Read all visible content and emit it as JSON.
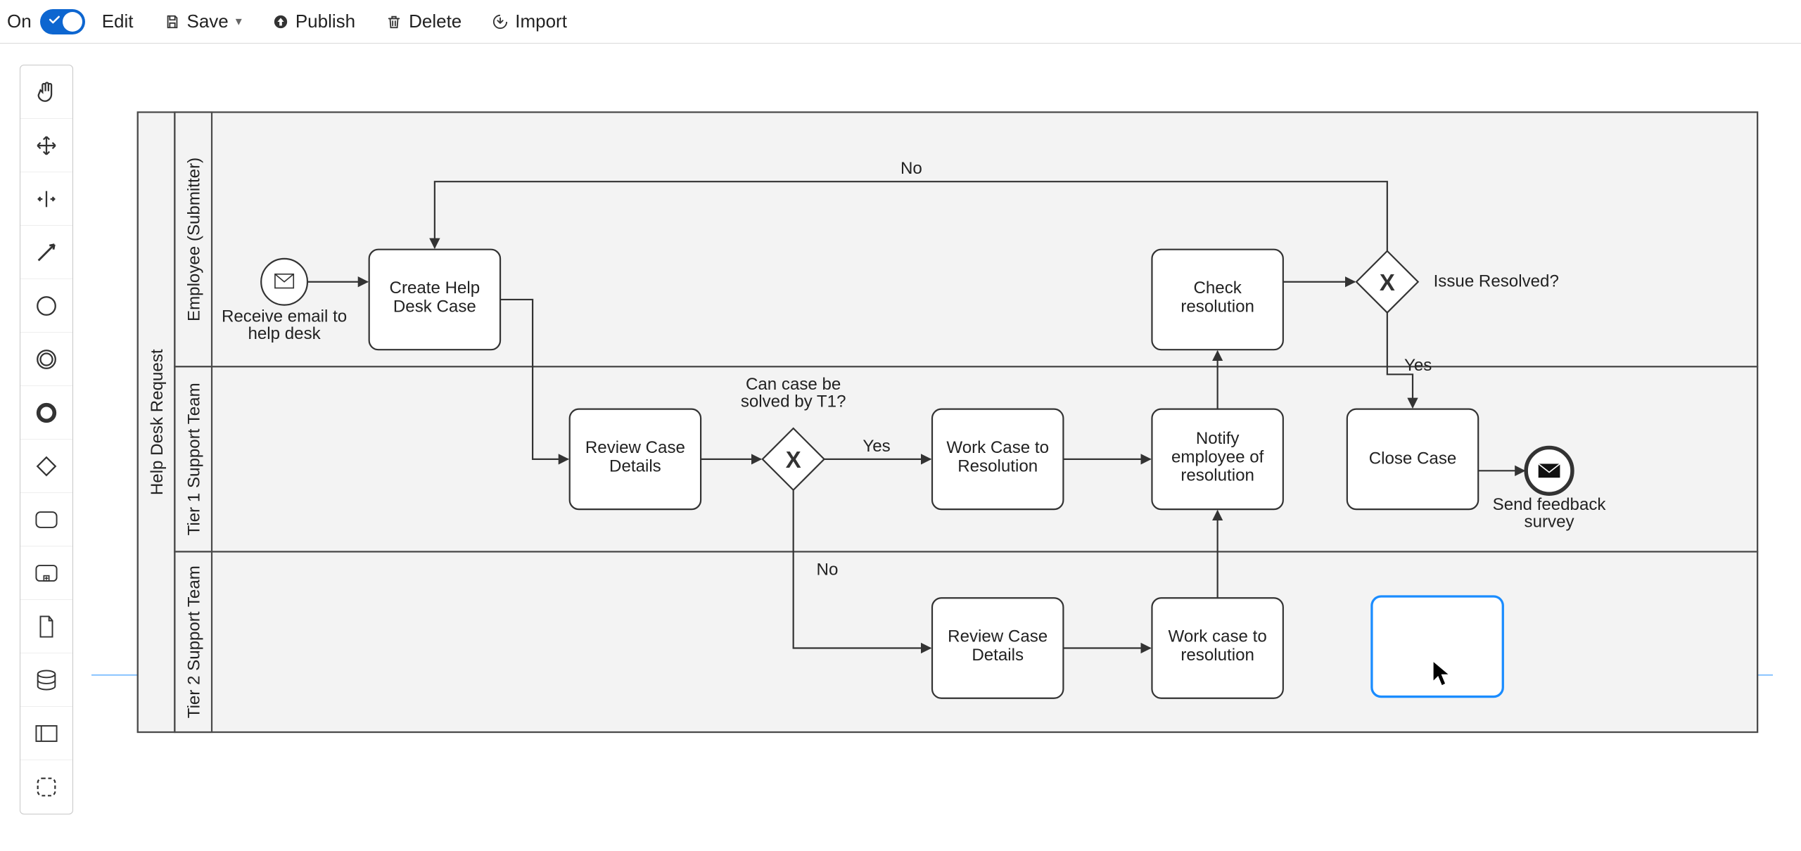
{
  "toolbar": {
    "on_label": "On",
    "toggle_on": true,
    "edit": "Edit",
    "save": "Save",
    "publish": "Publish",
    "delete": "Delete",
    "import": "Import"
  },
  "palette": {
    "tools": [
      "hand-tool",
      "move-tool",
      "split-tool",
      "connector-tool",
      "thin-circle-shape",
      "double-circle-shape",
      "thick-circle-shape",
      "diamond-shape",
      "rounded-rect-shape",
      "subprocess-shape",
      "document-shape",
      "datastore-shape",
      "card-shape",
      "marquee-select"
    ]
  },
  "diagram": {
    "pool_label": "Help Desk Request",
    "lanes": [
      {
        "id": "lane-employee",
        "label": "Employee (Submitter)"
      },
      {
        "id": "lane-t1",
        "label": "Tier 1 Support Team"
      },
      {
        "id": "lane-t2",
        "label": "Tier 2 Support Team"
      }
    ],
    "events": {
      "start_msg_label": "Receive email to help desk",
      "end_msg_label": "Send feedback survey"
    },
    "tasks": {
      "create_case": "Create Help Desk Case",
      "check_resolution": "Check resolution",
      "review_details_t1": "Review Case Details",
      "work_case_t1": "Work Case to Resolution",
      "notify_employee": "Notify employee of resolution",
      "close_case": "Close Case",
      "review_details_t2": "Review Case Details",
      "work_case_t2": "Work case to resolution"
    },
    "gateways": {
      "issue_resolved": {
        "label": "Issue Resolved?",
        "branches": {
          "no": "No",
          "yes": "Yes"
        }
      },
      "solved_by_t1": {
        "label": "Can case be solved by T1?",
        "branches": {
          "yes": "Yes",
          "no": "No"
        }
      }
    },
    "selected_new_task": ""
  }
}
